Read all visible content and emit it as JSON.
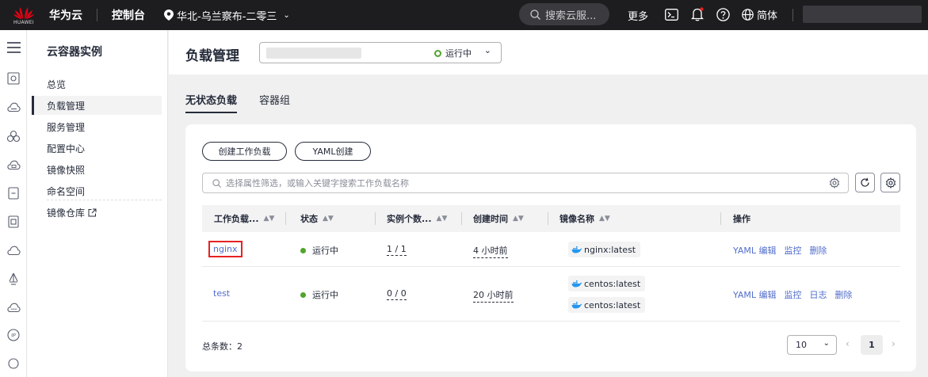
{
  "topbar": {
    "logo_text": "HUAWEI",
    "brand": "华为云",
    "console": "控制台",
    "region": "华北-乌兰察布-二零三",
    "search_placeholder": "搜索云服...",
    "more": "更多",
    "lang": "简体"
  },
  "sidebar": {
    "title": "云容器实例",
    "items": [
      {
        "label": "总览"
      },
      {
        "label": "负载管理"
      },
      {
        "label": "服务管理"
      },
      {
        "label": "配置中心"
      },
      {
        "label": "镜像快照"
      },
      {
        "label": "命名空间"
      },
      {
        "label": "镜像仓库"
      }
    ]
  },
  "header": {
    "title": "负载管理",
    "cluster_status": "运行中"
  },
  "tabs": [
    {
      "label": "无状态负载"
    },
    {
      "label": "容器组"
    }
  ],
  "toolbar": {
    "create_label": "创建工作负载",
    "yaml_label": "YAML创建",
    "filter_placeholder": "选择属性筛选，或输入关键字搜索工作负载名称"
  },
  "table": {
    "columns": [
      "工作负载...",
      "状态",
      "实例个数...",
      "创建时间",
      "镜像名称",
      "操作"
    ],
    "rows": [
      {
        "name": "nginx",
        "status": "运行中",
        "instances": "1 / 1",
        "created": "4 小时前",
        "images": [
          "nginx:latest"
        ],
        "ops": [
          "YAML 编辑",
          "监控",
          "删除"
        ]
      },
      {
        "name": "test",
        "status": "运行中",
        "instances": "0 / 0",
        "created": "20 小时前",
        "images": [
          "centos:latest",
          "centos:latest"
        ],
        "ops": [
          "YAML 编辑",
          "监控",
          "日志",
          "删除"
        ]
      }
    ]
  },
  "footer": {
    "total_label": "总条数：",
    "total": "2",
    "page_size": "10",
    "page": "1"
  },
  "colors": {
    "topbar_bg": "#1d1d20",
    "link": "#526ecc",
    "running": "#50a52c",
    "highlight_box": "#e62222"
  }
}
